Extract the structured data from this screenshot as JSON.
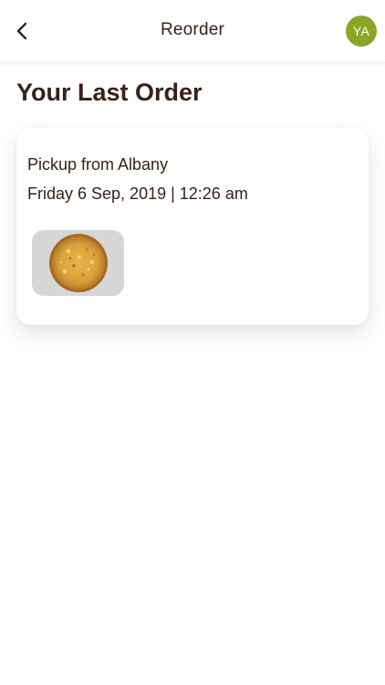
{
  "header": {
    "title": "Reorder",
    "back_icon": "chevron-left-icon",
    "avatar_initials": "YA",
    "avatar_color": "#8aa626"
  },
  "main": {
    "title": "Your Last Order",
    "order": {
      "pickup": "Pickup from Albany",
      "datetime": "Friday 6 Sep, 2019 | 12:26 am",
      "items": [
        {
          "icon": "pizza-image"
        }
      ]
    }
  },
  "colors": {
    "text": "#3a2118",
    "background": "#ffffff",
    "thumb_background": "#d6d6d6"
  }
}
